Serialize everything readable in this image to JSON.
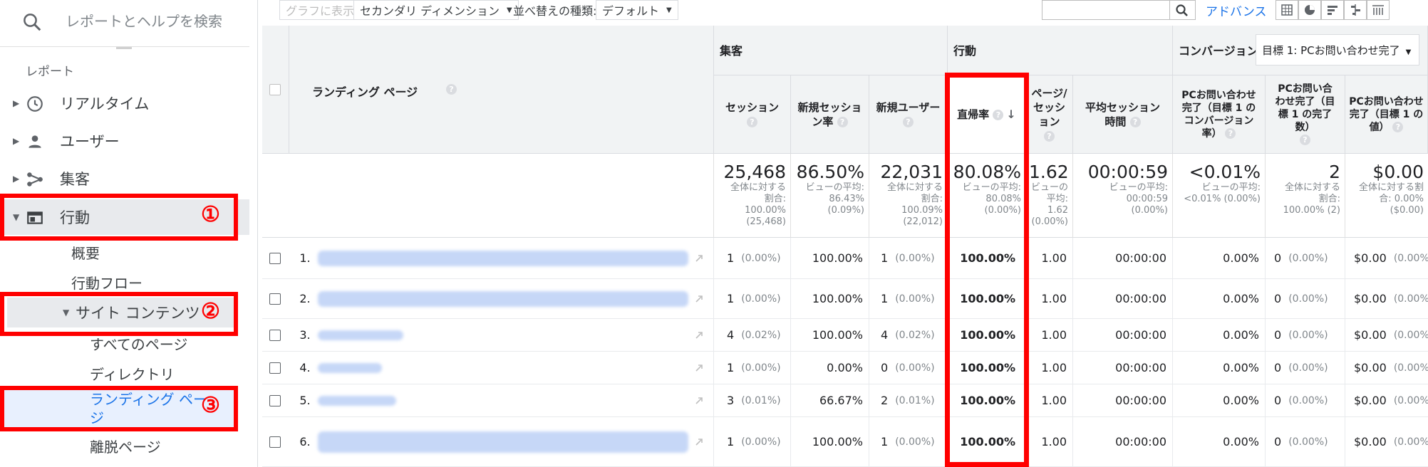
{
  "sidebar": {
    "search_placeholder": "レポートとヘルプを検索",
    "reports_label": "レポート",
    "nav": [
      {
        "label": "リアルタイム",
        "icon": "clock-icon"
      },
      {
        "label": "ユーザー",
        "icon": "person-icon"
      },
      {
        "label": "集客",
        "icon": "acquisition-icon"
      },
      {
        "label": "行動",
        "icon": "behavior-icon"
      }
    ],
    "behavior_sub": {
      "overview": "概要",
      "flow": "行動フロー",
      "site_content": "サイト コンテンツ",
      "all_pages": "すべてのページ",
      "directory": "ディレクトリ",
      "landing": "ランディング ページ",
      "exit": "離脱ページ"
    }
  },
  "annotations": {
    "one": "①",
    "two": "②",
    "three": "③",
    "color": "#ff0000"
  },
  "toolbar": {
    "graph_show": "グラフに表示",
    "secondary_dim": "セカンダリ ディメンション",
    "sort_type_label": "並べ替えの種類:",
    "sort_default": "デフォルト",
    "advanced": "アドバンス"
  },
  "table": {
    "groups": {
      "acq": "集客",
      "behavior": "行動",
      "conversion": "コンバージョン"
    },
    "goal_select": "目標 1: PCお問い合わせ完了",
    "dimension": "ランディング ページ",
    "headers": {
      "sessions": "セッション",
      "new_sessions_rate": "新規セッション率",
      "new_users": "新規ユーザー",
      "bounce_rate": "直帰率",
      "pages_per_session": "ページ/セッション",
      "avg_session": "平均セッション時間",
      "conv_rate": "PCお問い合わせ完了（目標 1 のコンバージョン率）",
      "completions": "PCお問い合わせ完了（目標 1 の完了数）",
      "value": "PCお問い合わせ完了（目標 1 の値）"
    },
    "totals": {
      "sessions": {
        "big": "25,468",
        "sm": "全体に対する割合: 100.00% (25,468)"
      },
      "new_sessions_rate": {
        "big": "86.50%",
        "sm": "ビューの平均: 86.43% (0.09%)"
      },
      "new_users": {
        "big": "22,031",
        "sm": "全体に対する割合: 100.09% (22,012)"
      },
      "bounce_rate": {
        "big": "80.08%",
        "sm": "ビューの平均: 80.08% (0.00%)"
      },
      "pages_per_session": {
        "big": "1.62",
        "sm": "ビューの平均: 1.62 (0.00%)"
      },
      "avg_session": {
        "big": "00:00:59",
        "sm": "ビューの平均: 00:00:59 (0.00%)"
      },
      "conv_rate": {
        "big": "<0.01%",
        "sm": "ビューの平均: <0.01% (0.00%)"
      },
      "completions": {
        "big": "2",
        "sm": "全体に対する割合: 100.00% (2)"
      },
      "value": {
        "big": "$0.00",
        "sm": "全体に対する割合: 0.00% ($0.00)"
      }
    },
    "rows": [
      {
        "idx": "1.",
        "sessions": "1",
        "sessions_pct": "(0.00%)",
        "nsr": "100.00%",
        "nu": "1",
        "nu_pct": "(0.00%)",
        "br": "100.00%",
        "pps": "1.00",
        "avg": "00:00:00",
        "cr": "0.00%",
        "comp": "0",
        "comp_pct": "(0.00%)",
        "val": "$0.00",
        "val_pct": "(0.00%)"
      },
      {
        "idx": "2.",
        "sessions": "1",
        "sessions_pct": "(0.00%)",
        "nsr": "100.00%",
        "nu": "1",
        "nu_pct": "(0.00%)",
        "br": "100.00%",
        "pps": "1.00",
        "avg": "00:00:00",
        "cr": "0.00%",
        "comp": "0",
        "comp_pct": "(0.00%)",
        "val": "$0.00",
        "val_pct": "(0.00%)"
      },
      {
        "idx": "3.",
        "sessions": "4",
        "sessions_pct": "(0.02%)",
        "nsr": "100.00%",
        "nu": "4",
        "nu_pct": "(0.02%)",
        "br": "100.00%",
        "pps": "1.00",
        "avg": "00:00:00",
        "cr": "0.00%",
        "comp": "0",
        "comp_pct": "(0.00%)",
        "val": "$0.00",
        "val_pct": "(0.00%)"
      },
      {
        "idx": "4.",
        "sessions": "1",
        "sessions_pct": "(0.00%)",
        "nsr": "0.00%",
        "nu": "0",
        "nu_pct": "(0.00%)",
        "br": "100.00%",
        "pps": "1.00",
        "avg": "00:00:00",
        "cr": "0.00%",
        "comp": "0",
        "comp_pct": "(0.00%)",
        "val": "$0.00",
        "val_pct": "(0.00%)"
      },
      {
        "idx": "5.",
        "sessions": "3",
        "sessions_pct": "(0.01%)",
        "nsr": "66.67%",
        "nu": "2",
        "nu_pct": "(0.01%)",
        "br": "100.00%",
        "pps": "1.00",
        "avg": "00:00:00",
        "cr": "0.00%",
        "comp": "0",
        "comp_pct": "(0.00%)",
        "val": "$0.00",
        "val_pct": "(0.00%)"
      },
      {
        "idx": "6.",
        "sessions": "1",
        "sessions_pct": "(0.00%)",
        "nsr": "100.00%",
        "nu": "1",
        "nu_pct": "(0.00%)",
        "br": "100.00%",
        "pps": "1.00",
        "avg": "00:00:00",
        "cr": "0.00%",
        "comp": "0",
        "comp_pct": "(0.00%)",
        "val": "$0.00",
        "val_pct": "(0.00%)"
      }
    ]
  }
}
